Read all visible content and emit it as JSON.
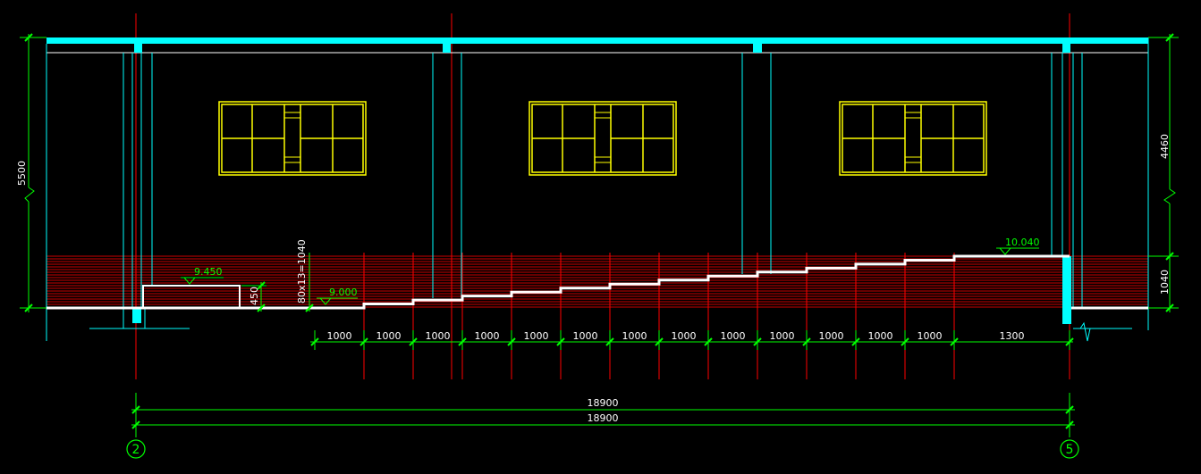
{
  "colors": {
    "background": "#000000",
    "structure": "#00ffff",
    "window": "#ffff00",
    "gridline": "#ff0000",
    "dimension": "#00ff00",
    "text": "#ffffff"
  },
  "left_dims": {
    "total": "5500"
  },
  "right_dims": {
    "upper": "4460",
    "lower": "1040"
  },
  "levels": {
    "top": "10.040",
    "landing": "9.450",
    "floor": "9.000"
  },
  "riser_note": "80x13=1040",
  "landing_step": "450",
  "step_dims": [
    "1000",
    "1000",
    "1000",
    "1000",
    "1000",
    "1000",
    "1000",
    "1000",
    "1000",
    "1000",
    "1000",
    "1000",
    "1000",
    "1300"
  ],
  "overall": [
    "18900",
    "18900"
  ],
  "axes": [
    "2",
    "5"
  ]
}
